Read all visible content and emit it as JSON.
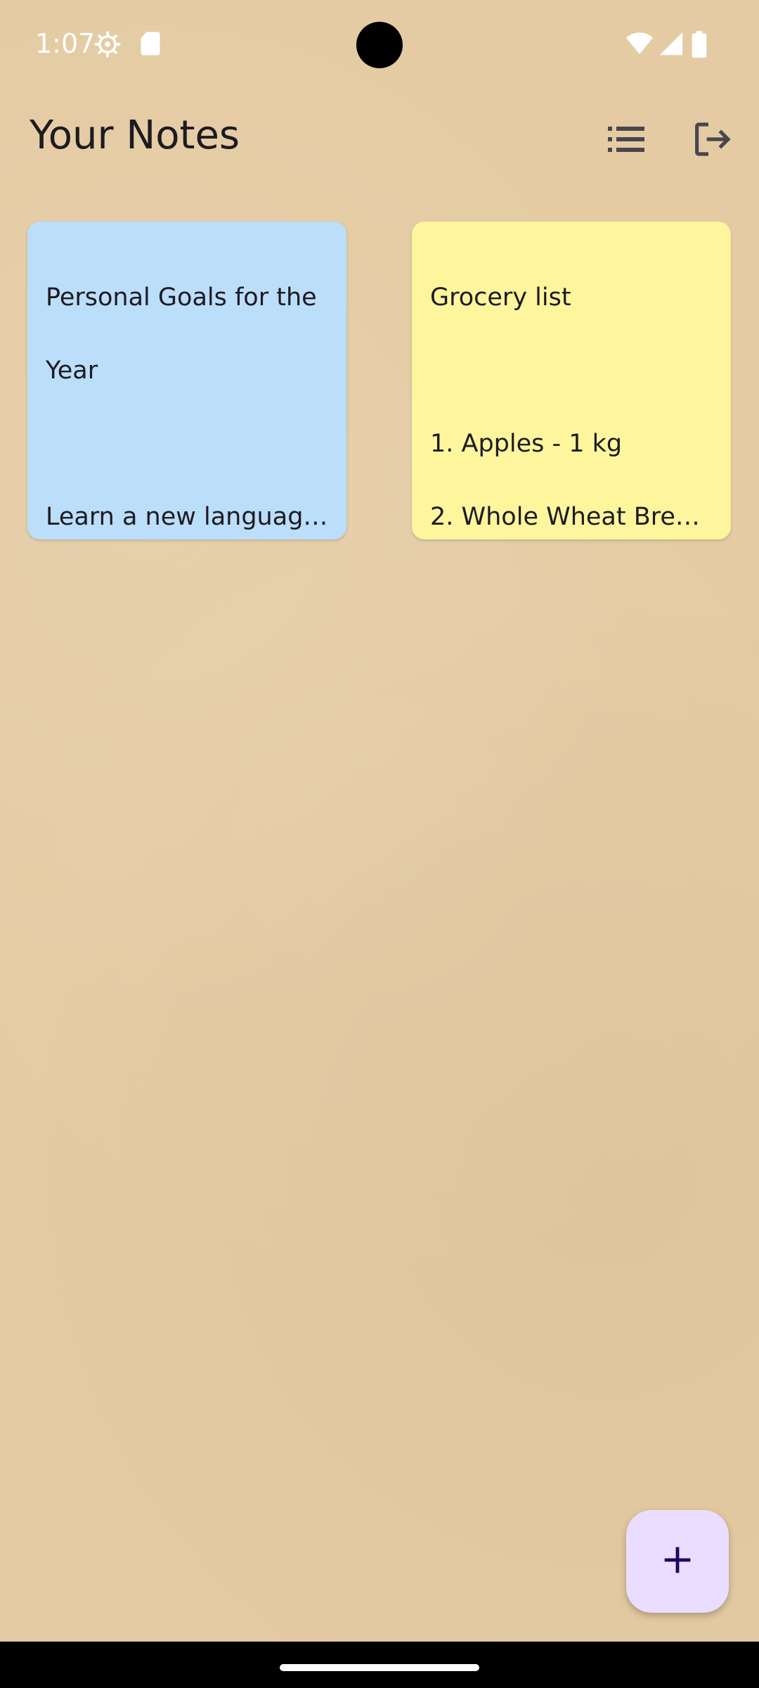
{
  "status_bar": {
    "time": "1:07",
    "icons": [
      "settings-gear-icon",
      "sd-card-icon",
      "wifi-icon",
      "signal-icon",
      "battery-icon"
    ]
  },
  "app_bar": {
    "title": "Your Notes",
    "actions": [
      {
        "icon": "list-view-icon"
      },
      {
        "icon": "logout-icon"
      }
    ]
  },
  "notes": [
    {
      "color": "#bbdefb",
      "title_line1": "Personal Goals for the",
      "title_line2": "Year",
      "body_line1": "Learn a new language…"
    },
    {
      "color": "#fff59d",
      "title_line1": "Grocery list",
      "body_line1": "1. Apples - 1 kg",
      "body_line2": "2. Whole Wheat Bread…"
    }
  ],
  "fab": {
    "icon": "plus-icon",
    "color": "#eaddff"
  },
  "colors": {
    "background": "#e4cba3",
    "text": "#1d1b20"
  }
}
